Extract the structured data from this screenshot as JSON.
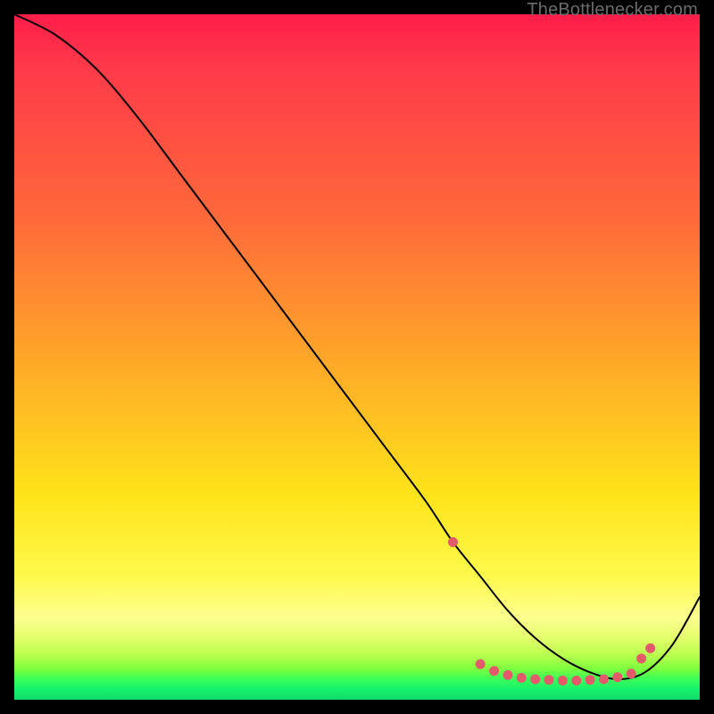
{
  "watermark": "TheBottlenecker.com",
  "chart_data": {
    "type": "line",
    "title": "",
    "xlabel": "",
    "ylabel": "",
    "xlim": [
      0,
      100
    ],
    "ylim": [
      0,
      100
    ],
    "x": [
      0,
      6,
      12,
      18,
      24,
      30,
      36,
      42,
      48,
      54,
      60,
      64,
      68,
      72,
      76,
      80,
      84,
      88,
      92,
      96,
      100
    ],
    "values": [
      100,
      97,
      92,
      85,
      77,
      69,
      61,
      53,
      45,
      37,
      29,
      23,
      18,
      13,
      9,
      6,
      4,
      3,
      4,
      8,
      15
    ],
    "curve_color": "#000000",
    "markers": {
      "color": "#e35a6a",
      "radius_px": 5.5,
      "points_xy": [
        [
          64,
          23
        ],
        [
          68,
          5.2
        ],
        [
          70,
          4.2
        ],
        [
          72,
          3.6
        ],
        [
          74,
          3.2
        ],
        [
          76,
          3.0
        ],
        [
          78,
          2.9
        ],
        [
          80,
          2.8
        ],
        [
          82,
          2.8
        ],
        [
          84,
          2.9
        ],
        [
          86,
          3.0
        ],
        [
          88,
          3.3
        ],
        [
          90,
          3.8
        ],
        [
          91.5,
          6.0
        ],
        [
          92.8,
          7.5
        ]
      ]
    },
    "gradient_stops": [
      {
        "pos": 0.0,
        "color": "#ff1d4a"
      },
      {
        "pos": 0.08,
        "color": "#ff3a4a"
      },
      {
        "pos": 0.3,
        "color": "#ff6a3a"
      },
      {
        "pos": 0.5,
        "color": "#ffa629"
      },
      {
        "pos": 0.7,
        "color": "#ffe31a"
      },
      {
        "pos": 0.82,
        "color": "#fff94c"
      },
      {
        "pos": 0.88,
        "color": "#fdff8f"
      },
      {
        "pos": 0.91,
        "color": "#e4ff6b"
      },
      {
        "pos": 0.935,
        "color": "#b8ff4e"
      },
      {
        "pos": 0.955,
        "color": "#7dff3d"
      },
      {
        "pos": 0.97,
        "color": "#3aff5a"
      },
      {
        "pos": 0.985,
        "color": "#15f06a"
      },
      {
        "pos": 1.0,
        "color": "#0fdc6b"
      }
    ]
  }
}
